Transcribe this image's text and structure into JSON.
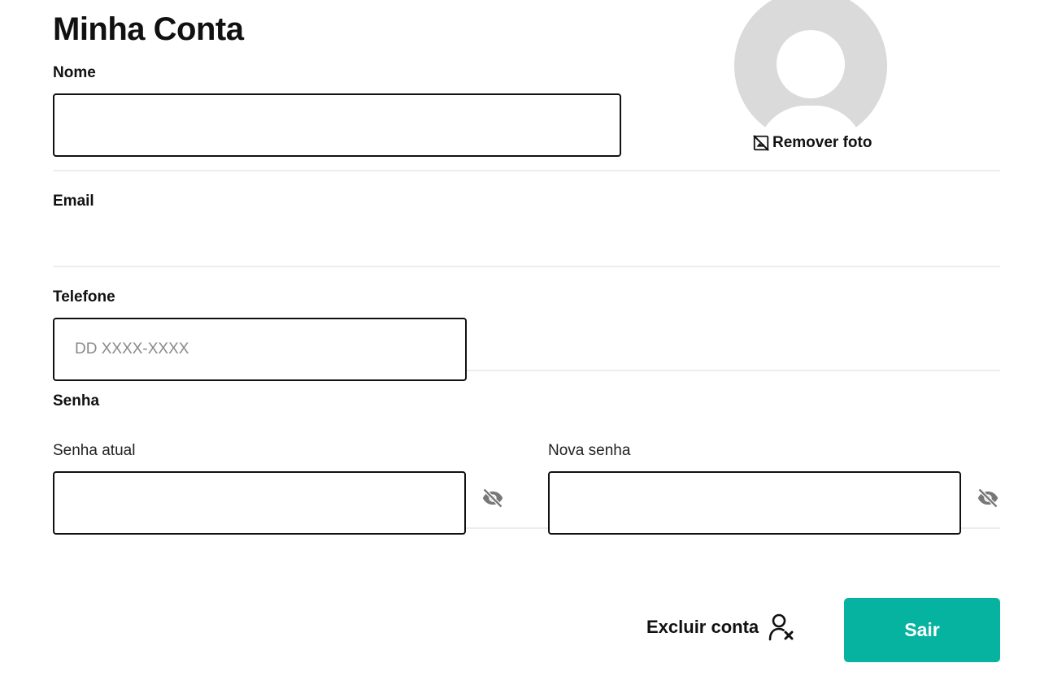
{
  "page": {
    "title": "Minha Conta"
  },
  "profile": {
    "remove_photo_label": "Remover foto",
    "remove_photo_icon": "no-photo-icon",
    "avatar_icon": "user-silhouette-icon"
  },
  "form": {
    "name": {
      "label": "Nome",
      "value": "",
      "placeholder": ""
    },
    "email": {
      "label": "Email",
      "value": ""
    },
    "phone": {
      "label": "Telefone",
      "value": "",
      "placeholder": "DD XXXX-XXXX"
    },
    "password": {
      "section_label": "Senha",
      "current": {
        "label": "Senha atual",
        "value": "",
        "visibility_icon": "eye-off-icon"
      },
      "new": {
        "label": "Nova senha",
        "value": "",
        "visibility_icon": "eye-off-icon"
      }
    }
  },
  "actions": {
    "delete_account_label": "Excluir conta",
    "delete_account_icon": "user-remove-icon",
    "logout_label": "Sair"
  },
  "colors": {
    "primary": "#06b2a0",
    "text": "#111111",
    "placeholder": "#8a8a8a",
    "avatar_bg": "#dadada",
    "divider": "#ededed",
    "icon_muted": "#777777"
  }
}
